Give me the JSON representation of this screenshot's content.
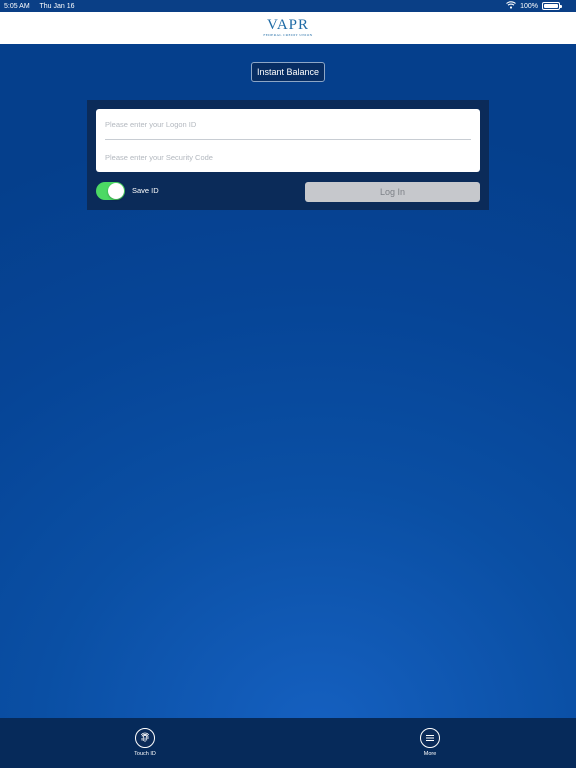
{
  "status_bar": {
    "time": "5:05 AM",
    "date": "Thu Jan 16",
    "battery": "100%"
  },
  "header": {
    "logo_main": "VAPR",
    "logo_sub": "Federal Credit Union"
  },
  "instant_balance": {
    "label": "Instant Balance"
  },
  "login": {
    "logon_placeholder": "Please enter your Logon ID",
    "code_placeholder": "Please enter your Security Code",
    "save_id_label": "Save ID",
    "save_id_on": true,
    "login_label": "Log In"
  },
  "tab_bar": {
    "items": [
      {
        "label": "Touch ID",
        "icon": "fingerprint-icon"
      },
      {
        "label": "More",
        "icon": "menu-icon"
      }
    ]
  },
  "colors": {
    "toggle_on": "#4cd964",
    "panel": "#0b2b59",
    "brand": "#1e6aa5"
  }
}
